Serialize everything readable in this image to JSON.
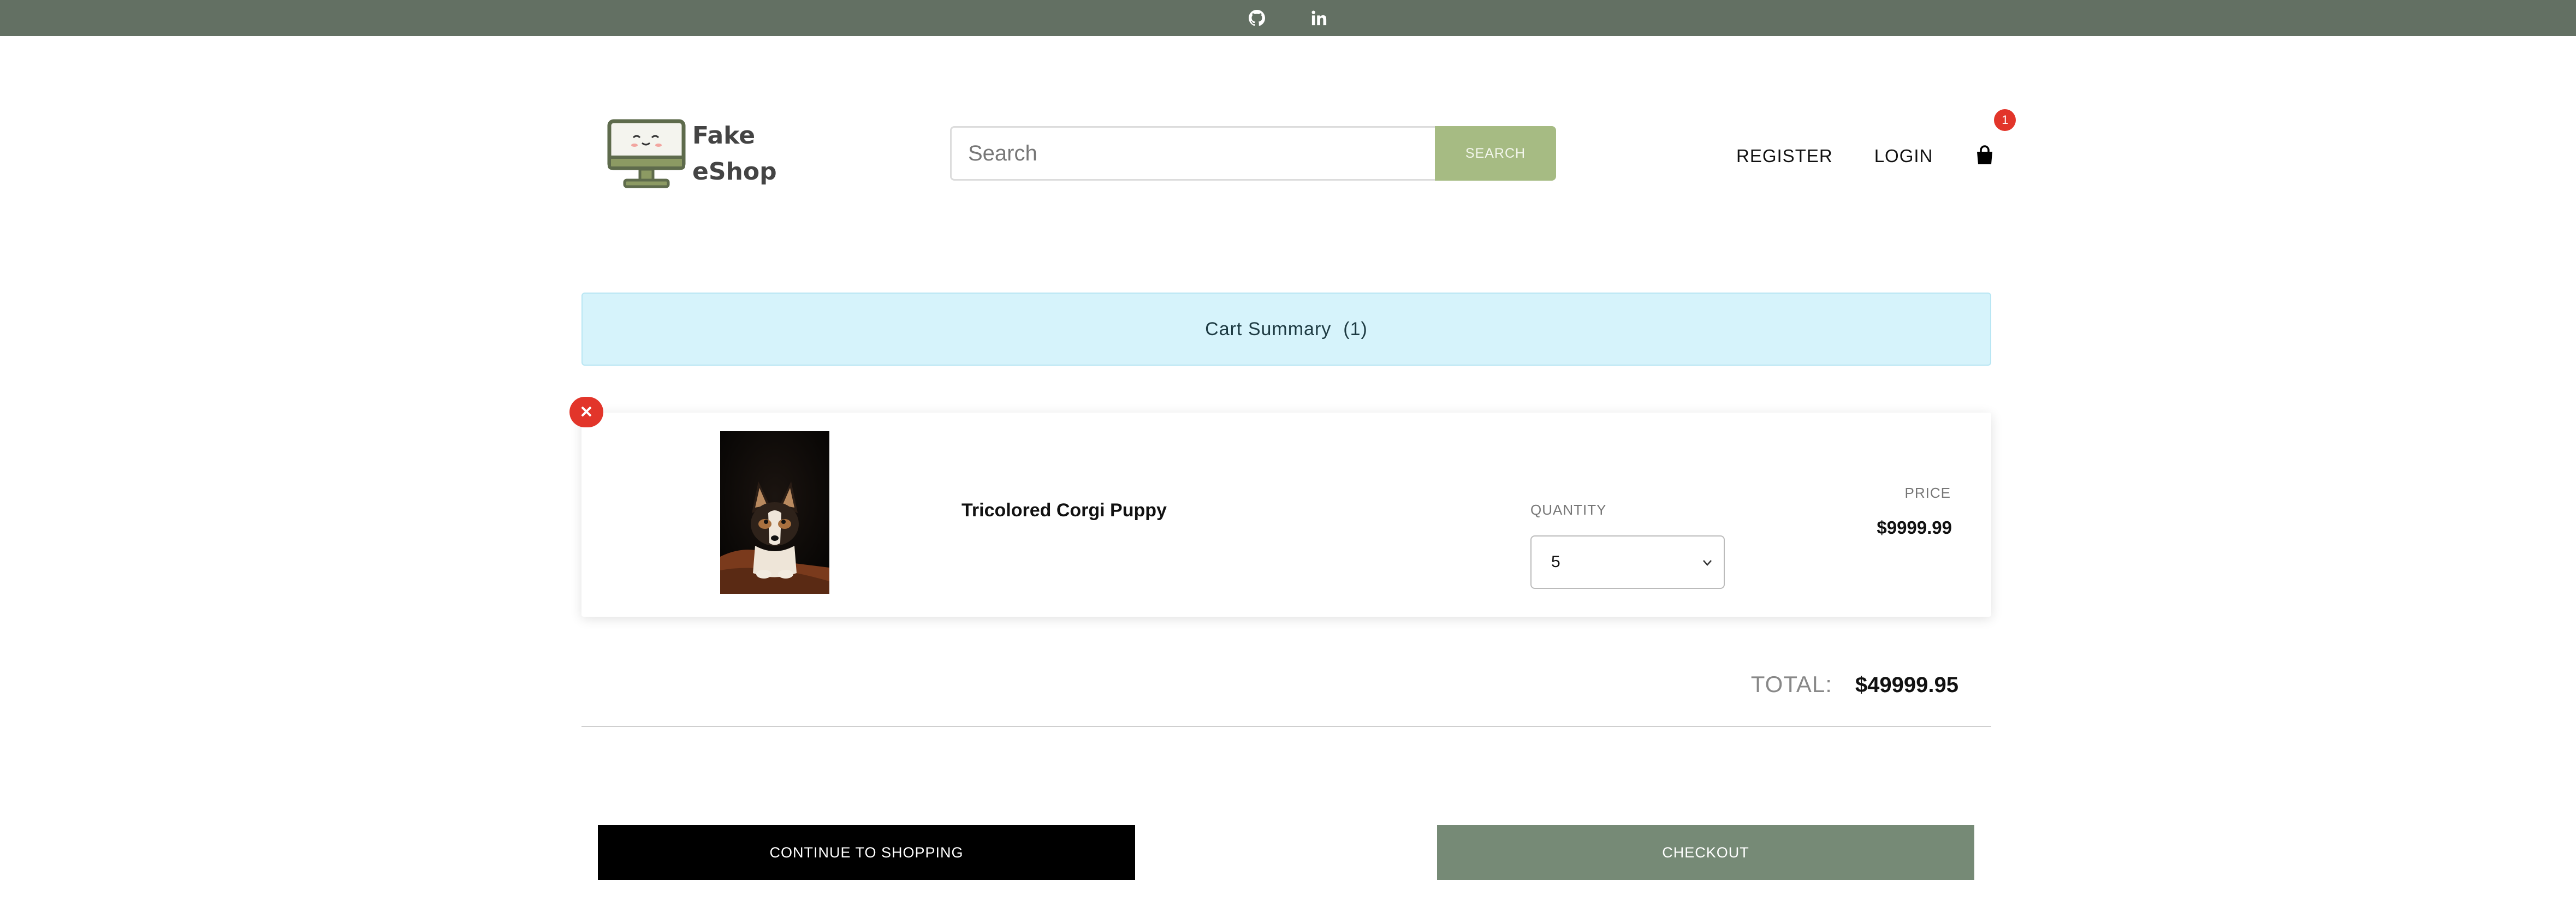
{
  "topbar": {
    "links": [
      {
        "icon": "github-icon"
      },
      {
        "icon": "linkedin-icon"
      }
    ]
  },
  "header": {
    "logo_line1": "Fake",
    "logo_line2": "eShop",
    "search_placeholder": "Search",
    "search_button": "SEARCH",
    "register": "REGISTER",
    "login": "LOGIN",
    "cart_count": "1"
  },
  "summary": {
    "title": "Cart Summary",
    "count": "(1)"
  },
  "cart": {
    "items": [
      {
        "name": "Tricolored Corgi Puppy",
        "quantity_label": "QUANTITY",
        "quantity": "5",
        "price_label": "PRICE",
        "price": "$9999.99",
        "remove_symbol": "✕"
      }
    ]
  },
  "totals": {
    "label": "TOTAL:",
    "value": "$49999.95"
  },
  "actions": {
    "continue": "CONTINUE TO SHOPPING",
    "checkout": "CHECKOUT"
  },
  "colors": {
    "topbar": "#637063",
    "search_button": "#a6bb83",
    "summary_bg": "#d6f3fb",
    "badge": "#e2352a",
    "checkout": "#768a76"
  }
}
